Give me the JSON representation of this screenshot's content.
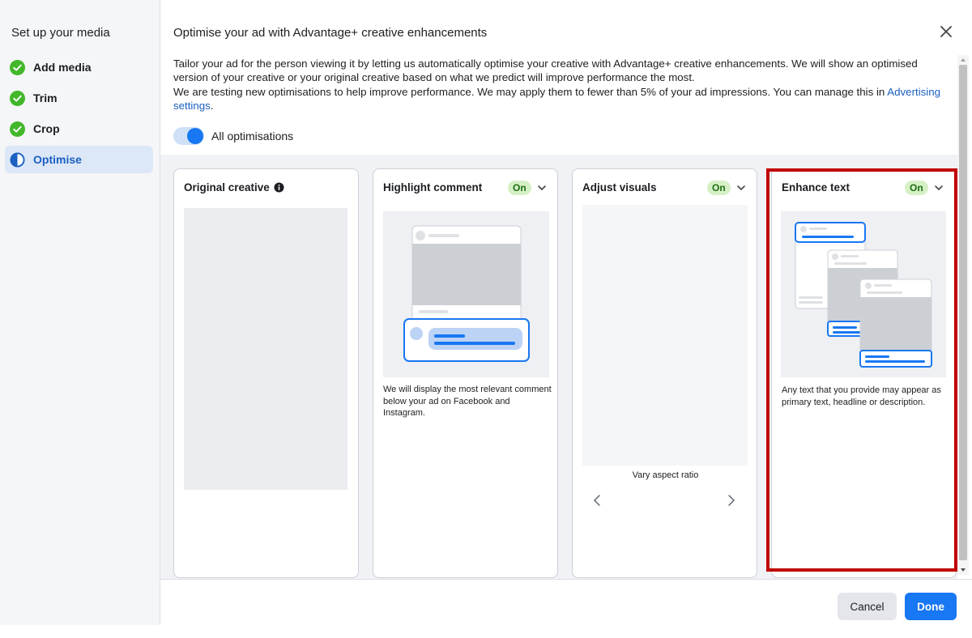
{
  "sidebar": {
    "title": "Set up your media",
    "steps": [
      {
        "label": "Add media",
        "status": "done"
      },
      {
        "label": "Trim",
        "status": "done"
      },
      {
        "label": "Crop",
        "status": "done"
      },
      {
        "label": "Optimise",
        "status": "active"
      }
    ]
  },
  "header": {
    "title": "Optimise your ad with Advantage+ creative enhancements",
    "close_icon": "close-icon"
  },
  "description": {
    "line1": "Tailor your ad for the person viewing it by letting us automatically optimise your creative with Advantage+ creative enhancements. We will show an optimised version of your creative or your original creative based on what we predict will improve performance the most.",
    "line2": "We are testing new optimisations to help improve performance. We may apply them to fewer than 5% of your ad impressions. You can manage this in",
    "link": "Advertising settings",
    "link_suffix": "."
  },
  "toggle": {
    "label": "All optimisations",
    "on": true
  },
  "cards": {
    "original": {
      "title": "Original creative"
    },
    "highlight": {
      "title": "Highlight comment",
      "badge": "On",
      "desc": "We will display the most relevant comment below your ad on Facebook and Instagram."
    },
    "adjust": {
      "title": "Adjust visuals",
      "badge": "On",
      "caption": "Vary aspect ratio"
    },
    "enhance": {
      "title": "Enhance text",
      "badge": "On",
      "desc": "Any text that you provide may appear as primary text, headline or description."
    }
  },
  "footer": {
    "cancel": "Cancel",
    "done": "Done"
  },
  "colors": {
    "accent": "#1877f2",
    "success": "#42b72a",
    "badge_bg": "#d6f0c6",
    "highlight": "#c00000"
  }
}
